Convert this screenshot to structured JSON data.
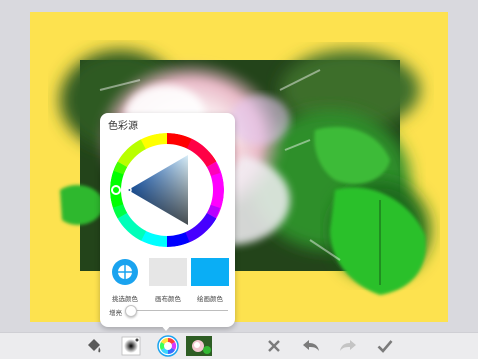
{
  "popup": {
    "title": "色彩源",
    "swatches": [
      {
        "label": "挑选颜色",
        "color": "#ffffff"
      },
      {
        "label": "画布颜色",
        "color": "#e6e6e6"
      },
      {
        "label": "绘画颜色",
        "color": "#0aaef5"
      }
    ],
    "opacity_label": "增亮",
    "opacity_value": 0.05,
    "selected_hue_color": "#1e6dd8"
  },
  "canvas": {
    "background_color": "#fde24f"
  },
  "toolbar": {
    "icons": [
      "paint-bucket-icon",
      "brush-tip-icon",
      "color-wheel-icon",
      "artwork-thumbnail-icon",
      "close-icon",
      "undo-icon",
      "redo-icon",
      "checkmark-icon"
    ]
  }
}
